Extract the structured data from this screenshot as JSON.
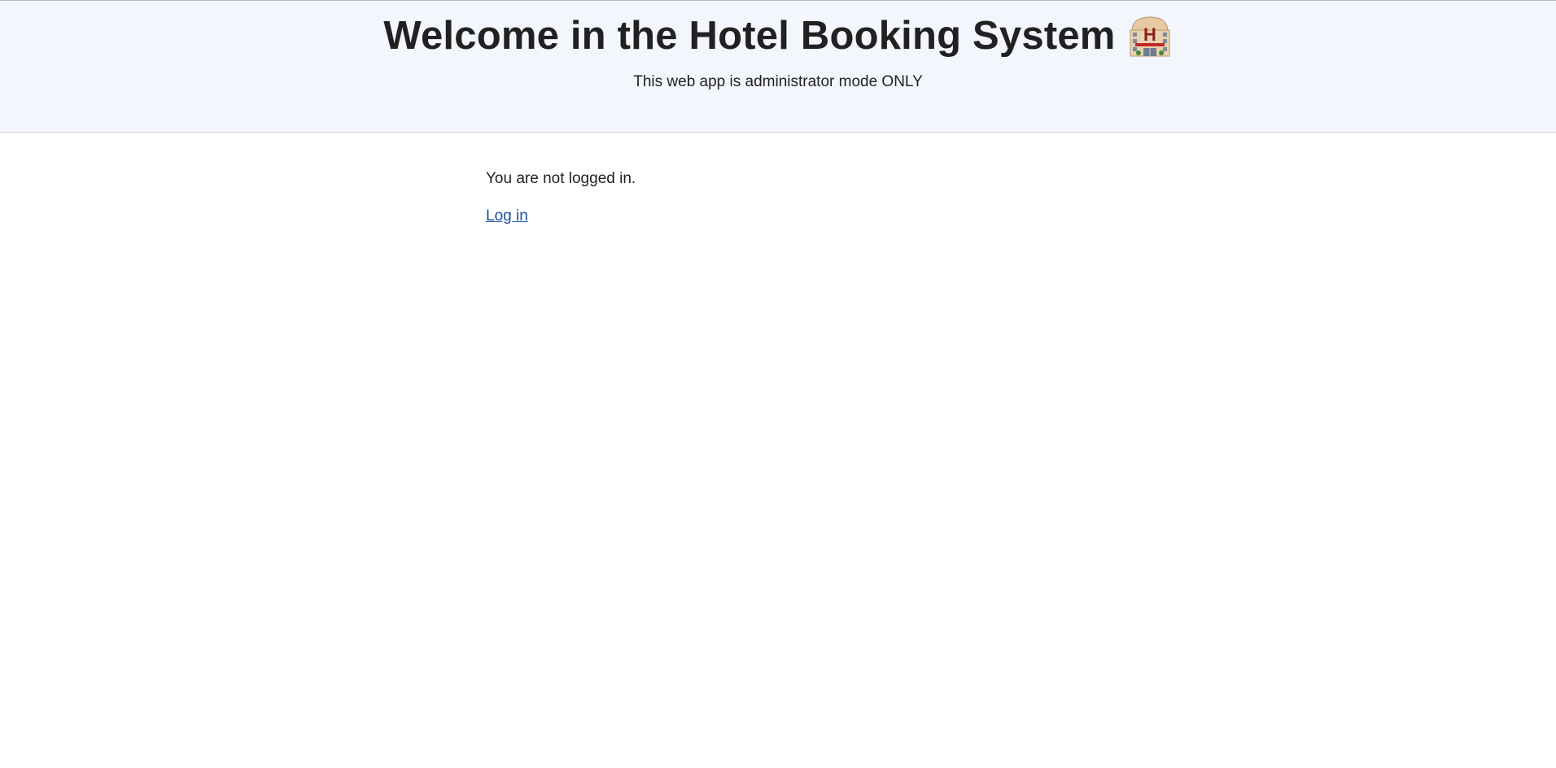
{
  "header": {
    "title": "Welcome in the Hotel Booking System",
    "title_icon": "hotel-icon",
    "subtitle": "This web app is administrator mode ONLY"
  },
  "main": {
    "status_text": "You are not logged in.",
    "login_link_label": "Log in"
  },
  "colors": {
    "header_background": "#f3f6fc",
    "text": "#212121",
    "link": "#1a4fa3"
  }
}
